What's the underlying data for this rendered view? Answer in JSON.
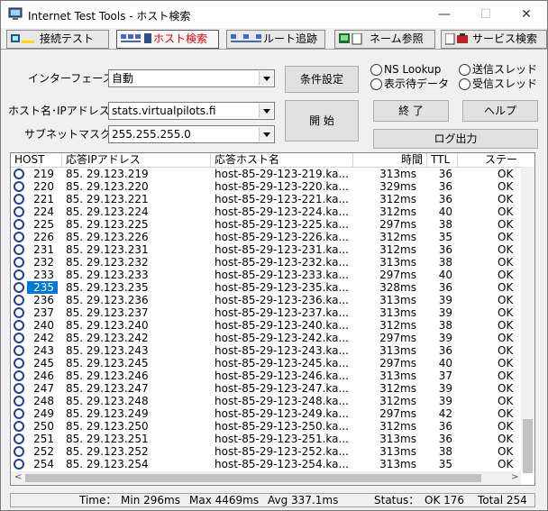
{
  "window": {
    "title": "Internet Test Tools - ホスト検索",
    "min": "—",
    "max": "☐",
    "close": "✕"
  },
  "tabs": [
    {
      "label": "接続テスト",
      "icon": "connection-test-icon"
    },
    {
      "label": "ホスト検索",
      "icon": "host-search-icon",
      "color": "#e00000"
    },
    {
      "label": "ルート追跡",
      "icon": "route-trace-icon"
    },
    {
      "label": "ネーム参照",
      "icon": "name-lookup-icon"
    },
    {
      "label": "サービス検索",
      "icon": "service-search-icon"
    }
  ],
  "form": {
    "interface_label": "インターフェース",
    "interface_value": "自動",
    "host_label": "ホスト名･IPアドレス",
    "host_value": "stats.virtualpilots.fi",
    "subnet_label": "サブネットマスク",
    "subnet_value": "255.255.255.0",
    "cond_button": "条件設定",
    "start_button": "開 始",
    "end_button": "終 了",
    "help_button": "ヘルプ",
    "log_button": "ログ出力",
    "radio_ns": "NS Lookup",
    "radio_send": "送信スレッド",
    "radio_display": "表示待データ",
    "radio_recv": "受信スレッド"
  },
  "table": {
    "headers": [
      "HOST",
      "応答IPアドレス",
      "応答ホスト名",
      "時間",
      "TTL",
      "ステー"
    ],
    "selected_index": 9,
    "rows": [
      [
        "219",
        "85. 29.123.219",
        "host-85-29-123-219.ka...",
        "313ms",
        "36",
        "OK"
      ],
      [
        "220",
        "85. 29.123.220",
        "host-85-29-123-220.ka...",
        "329ms",
        "36",
        "OK"
      ],
      [
        "221",
        "85. 29.123.221",
        "host-85-29-123-221.ka...",
        "312ms",
        "36",
        "OK"
      ],
      [
        "224",
        "85. 29.123.224",
        "host-85-29-123-224.ka...",
        "312ms",
        "40",
        "OK"
      ],
      [
        "225",
        "85. 29.123.225",
        "host-85-29-123-225.ka...",
        "297ms",
        "38",
        "OK"
      ],
      [
        "226",
        "85. 29.123.226",
        "host-85-29-123-226.ka...",
        "312ms",
        "35",
        "OK"
      ],
      [
        "231",
        "85. 29.123.231",
        "host-85-29-123-231.ka...",
        "312ms",
        "36",
        "OK"
      ],
      [
        "232",
        "85. 29.123.232",
        "host-85-29-123-232.ka...",
        "313ms",
        "38",
        "OK"
      ],
      [
        "233",
        "85. 29.123.233",
        "host-85-29-123-233.ka...",
        "297ms",
        "40",
        "OK"
      ],
      [
        "235",
        "85. 29.123.235",
        "host-85-29-123-235.ka...",
        "328ms",
        "36",
        "OK"
      ],
      [
        "236",
        "85. 29.123.236",
        "host-85-29-123-236.ka...",
        "313ms",
        "39",
        "OK"
      ],
      [
        "237",
        "85. 29.123.237",
        "host-85-29-123-237.ka...",
        "313ms",
        "39",
        "OK"
      ],
      [
        "240",
        "85. 29.123.240",
        "host-85-29-123-240.ka...",
        "312ms",
        "38",
        "OK"
      ],
      [
        "242",
        "85. 29.123.242",
        "host-85-29-123-242.ka...",
        "297ms",
        "39",
        "OK"
      ],
      [
        "243",
        "85. 29.123.243",
        "host-85-29-123-243.ka...",
        "313ms",
        "36",
        "OK"
      ],
      [
        "245",
        "85. 29.123.245",
        "host-85-29-123-245.ka...",
        "297ms",
        "40",
        "OK"
      ],
      [
        "246",
        "85. 29.123.246",
        "host-85-29-123-246.ka...",
        "313ms",
        "37",
        "OK"
      ],
      [
        "247",
        "85. 29.123.247",
        "host-85-29-123-247.ka...",
        "312ms",
        "39",
        "OK"
      ],
      [
        "248",
        "85. 29.123.248",
        "host-85-29-123-248.ka...",
        "312ms",
        "39",
        "OK"
      ],
      [
        "249",
        "85. 29.123.249",
        "host-85-29-123-249.ka...",
        "297ms",
        "42",
        "OK"
      ],
      [
        "250",
        "85. 29.123.250",
        "host-85-29-123-250.ka...",
        "312ms",
        "36",
        "OK"
      ],
      [
        "251",
        "85. 29.123.251",
        "host-85-29-123-251.ka...",
        "313ms",
        "36",
        "OK"
      ],
      [
        "252",
        "85. 29.123.252",
        "host-85-29-123-252.ka...",
        "313ms",
        "38",
        "OK"
      ],
      [
        "254",
        "85. 29.123.254",
        "host-85-29-123-254.ka...",
        "313ms",
        "35",
        "OK"
      ]
    ]
  },
  "status": {
    "time_label": "Time：",
    "min": "Min 296ms",
    "max": "Max 4469ms",
    "avg": "Avg 337.1ms",
    "status_label": "Status：",
    "ok": "OK 176",
    "total": "Total 254"
  },
  "colors": {
    "selection": "#0078d7",
    "row_icon": "#1f3fa8",
    "active_tab_text": "#e00000"
  }
}
